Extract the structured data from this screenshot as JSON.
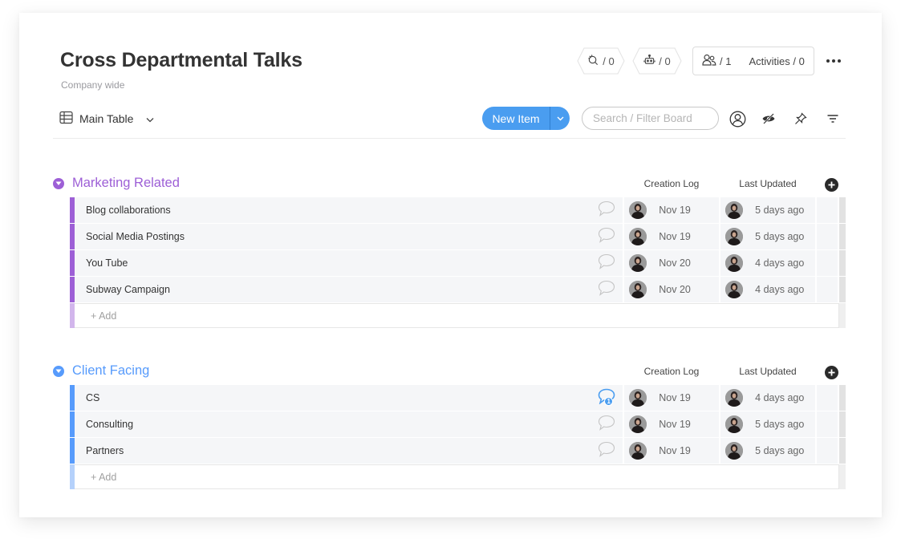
{
  "board": {
    "title": "Cross Departmental Talks",
    "subtitle": "Company wide"
  },
  "header": {
    "integrations": {
      "icon": "integrations-icon",
      "count": "/ 0"
    },
    "automations": {
      "icon": "robot-icon",
      "count": "/ 0"
    },
    "members": {
      "icon": "people-icon",
      "count": "/ 1"
    },
    "activities_label": "Activities / 0",
    "more_icon": "more-dots-icon"
  },
  "toolbar": {
    "view_label": "Main Table",
    "new_item_label": "New Item",
    "search_placeholder": "Search / Filter Board",
    "search_value": "",
    "icons": [
      "person-icon",
      "hide-icon",
      "pin-icon",
      "filter-icon"
    ]
  },
  "colors": {
    "accent": "#4a9df0",
    "group_marketing": "#9d5fd6",
    "group_marketing_light": "#d2b6ec",
    "group_client": "#579bfc",
    "group_client_light": "#b5d1fb"
  },
  "groups": [
    {
      "title": "Marketing Related",
      "columns": [
        "Creation Log",
        "Last Updated"
      ],
      "add_label": "+ Add",
      "items": [
        {
          "name": "Blog collaborations",
          "comments": "",
          "created": "Nov 19",
          "updated": "5 days ago"
        },
        {
          "name": "Social Media Postings",
          "comments": "",
          "created": "Nov 19",
          "updated": "5 days ago"
        },
        {
          "name": "You Tube",
          "comments": "",
          "created": "Nov 20",
          "updated": "4 days ago"
        },
        {
          "name": "Subway Campaign",
          "comments": "",
          "created": "Nov 20",
          "updated": "4 days ago"
        }
      ]
    },
    {
      "title": "Client Facing",
      "columns": [
        "Creation Log",
        "Last Updated"
      ],
      "add_label": "+ Add",
      "items": [
        {
          "name": "CS",
          "comments": "1",
          "created": "Nov 19",
          "updated": "4 days ago"
        },
        {
          "name": "Consulting",
          "comments": "",
          "created": "Nov 19",
          "updated": "5 days ago"
        },
        {
          "name": "Partners",
          "comments": "",
          "created": "Nov 19",
          "updated": "5 days ago"
        }
      ]
    }
  ]
}
